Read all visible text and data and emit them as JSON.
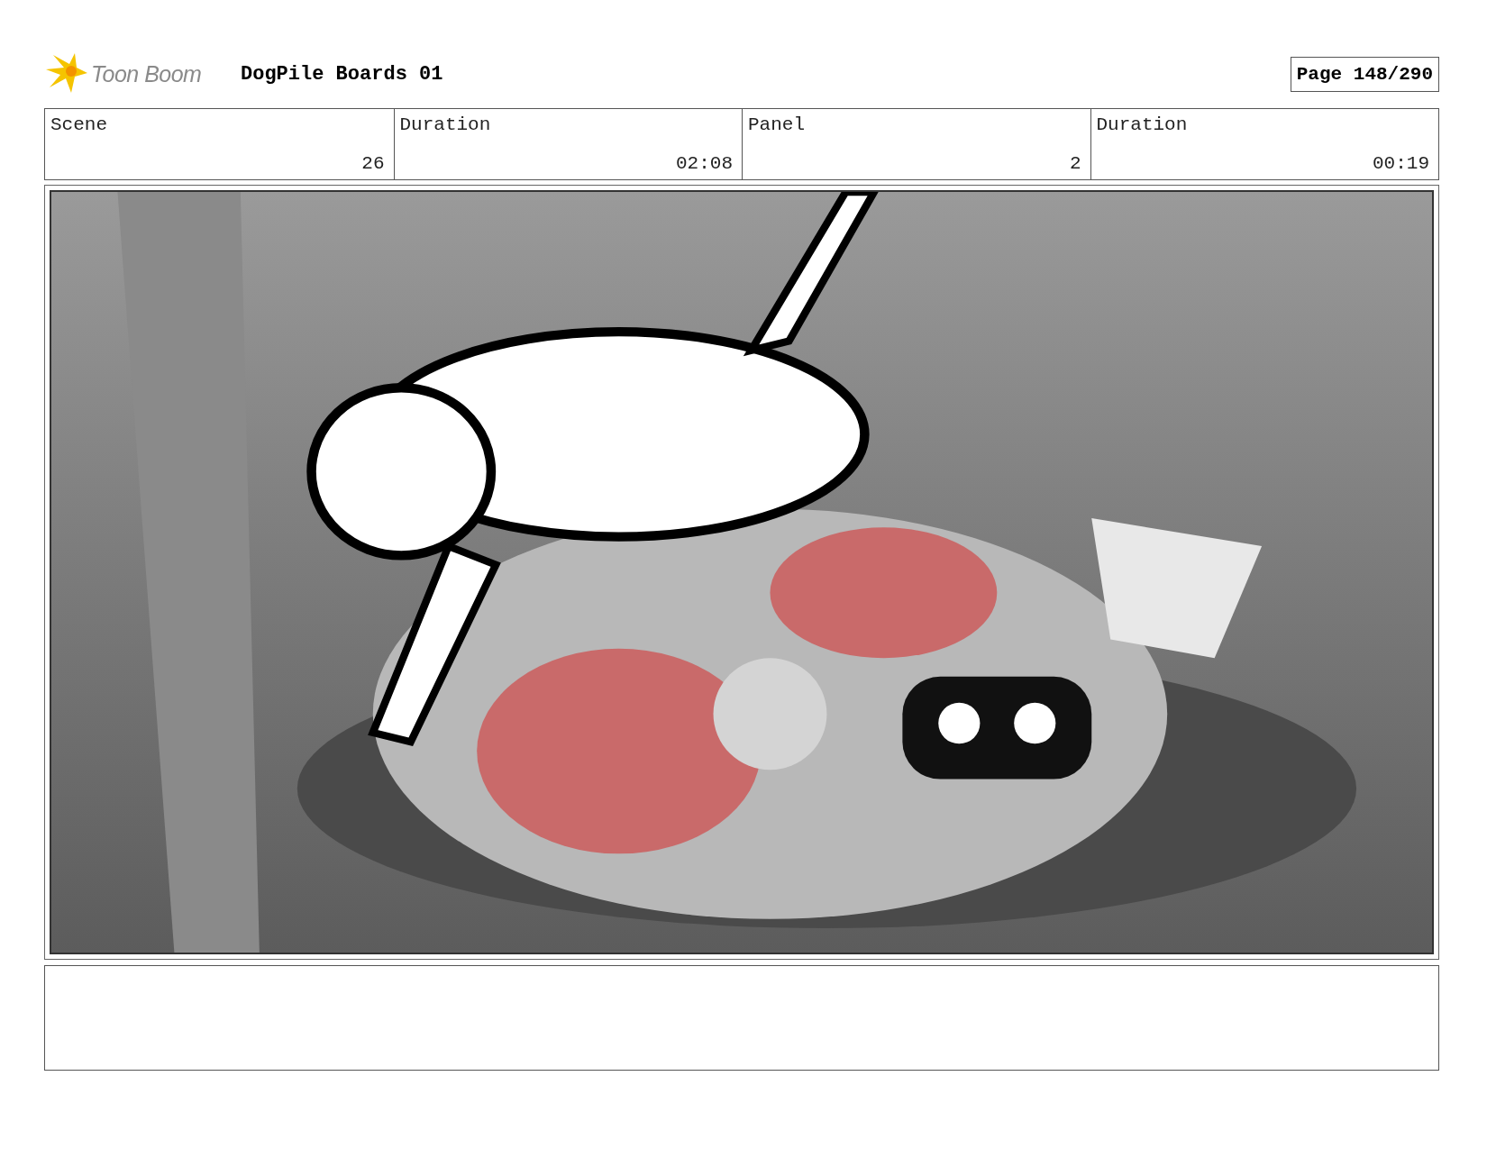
{
  "header": {
    "logo_text": "Toon Boom",
    "title": "DogPile Boards 01",
    "page": "Page 148/290"
  },
  "info_table": {
    "labels": [
      "Scene",
      "Duration",
      "Panel",
      "Duration"
    ],
    "values": [
      "26",
      "02:08",
      "2",
      "00:19"
    ]
  }
}
